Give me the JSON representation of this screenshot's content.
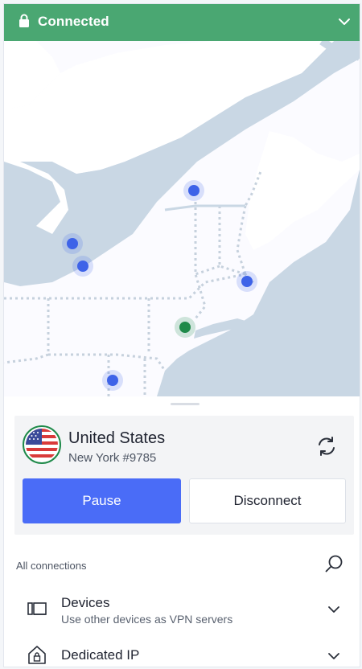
{
  "status": {
    "label": "Connected",
    "lock_icon": "lock-icon",
    "chevron_icon": "chevron-down-icon",
    "color": "#4aa772"
  },
  "map": {
    "land_color": "#c8d6e3",
    "marker_color": "#3e63e8",
    "active_marker_color": "#1f8a4a"
  },
  "connection": {
    "country": "United States",
    "server": "New York #9785",
    "flag_icon": "us-flag-icon",
    "refresh_icon": "refresh-icon"
  },
  "actions": {
    "pause": "Pause",
    "disconnect": "Disconnect",
    "pause_color": "#4a6cf7"
  },
  "connections": {
    "title": "All connections",
    "search_icon": "search-icon",
    "items": [
      {
        "title": "Devices",
        "subtitle": "Use other devices as VPN servers",
        "icon": "devices-icon"
      },
      {
        "title": "Dedicated IP",
        "subtitle": "",
        "icon": "home-lock-icon"
      }
    ]
  }
}
